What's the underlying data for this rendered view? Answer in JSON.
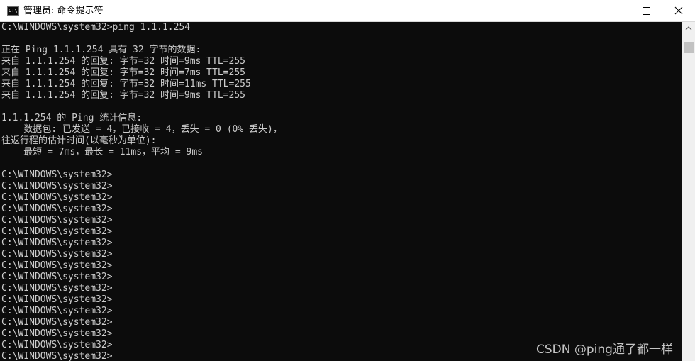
{
  "window": {
    "title": "管理员: 命令提示符",
    "icon_label": "C:\\"
  },
  "controls": {
    "minimize_icon": "minimize-icon",
    "maximize_icon": "maximize-icon",
    "close_icon": "close-icon"
  },
  "console": {
    "lines": [
      "C:\\WINDOWS\\system32>ping 1.1.1.254",
      "",
      "正在 Ping 1.1.1.254 具有 32 字节的数据:",
      "来自 1.1.1.254 的回复: 字节=32 时间=9ms TTL=255",
      "来自 1.1.1.254 的回复: 字节=32 时间=7ms TTL=255",
      "来自 1.1.1.254 的回复: 字节=32 时间=11ms TTL=255",
      "来自 1.1.1.254 的回复: 字节=32 时间=9ms TTL=255",
      "",
      "1.1.1.254 的 Ping 统计信息:",
      "    数据包: 已发送 = 4，已接收 = 4，丢失 = 0 (0% 丢失)，",
      "往返行程的估计时间(以毫秒为单位):",
      "    最短 = 7ms，最长 = 11ms，平均 = 9ms",
      "",
      "C:\\WINDOWS\\system32>",
      "C:\\WINDOWS\\system32>",
      "C:\\WINDOWS\\system32>",
      "C:\\WINDOWS\\system32>",
      "C:\\WINDOWS\\system32>",
      "C:\\WINDOWS\\system32>",
      "C:\\WINDOWS\\system32>",
      "C:\\WINDOWS\\system32>",
      "C:\\WINDOWS\\system32>",
      "C:\\WINDOWS\\system32>",
      "C:\\WINDOWS\\system32>",
      "C:\\WINDOWS\\system32>",
      "C:\\WINDOWS\\system32>",
      "C:\\WINDOWS\\system32>",
      "C:\\WINDOWS\\system32>",
      "C:\\WINDOWS\\system32>",
      "C:\\WINDOWS\\system32>"
    ]
  },
  "watermark": "CSDN @ping通了都一样",
  "colors": {
    "console_bg": "#0c0c0c",
    "console_text": "#cccccc",
    "titlebar_bg": "#ffffff"
  }
}
